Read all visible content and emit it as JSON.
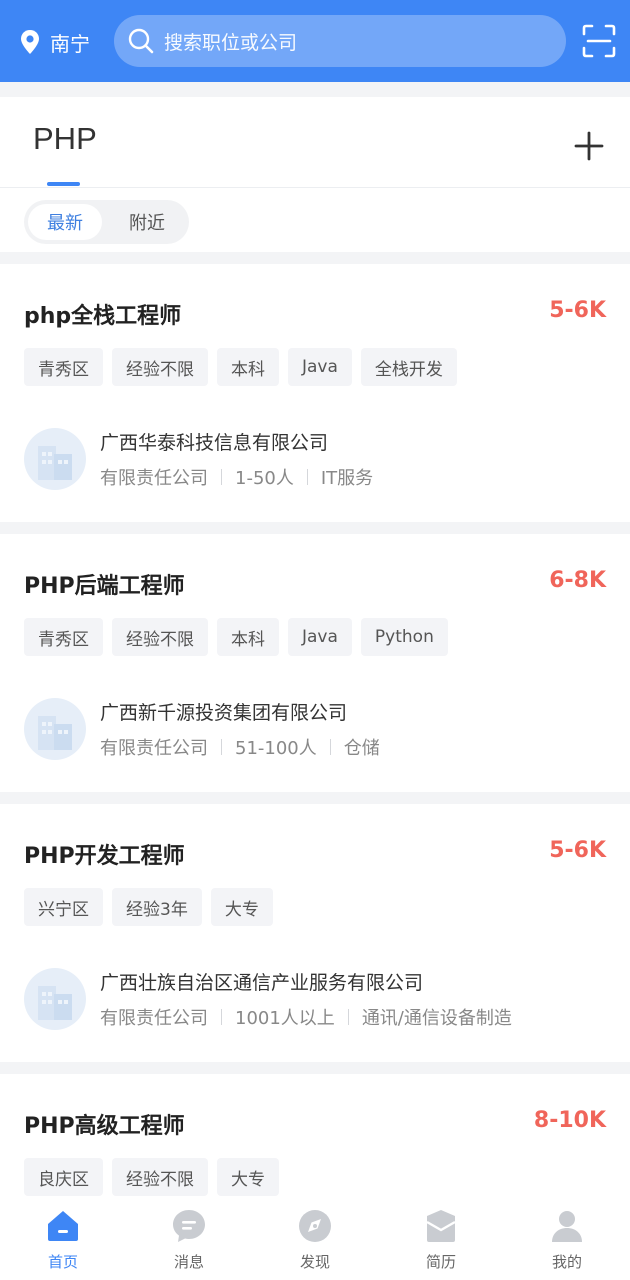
{
  "header": {
    "city": "南宁",
    "search_placeholder": "搜索职位或公司"
  },
  "filter": {
    "keyword_tab": "PHP",
    "sort_options": [
      "最新",
      "附近"
    ],
    "selected_sort": "最新"
  },
  "jobs": [
    {
      "title": "php全栈工程师",
      "salary": "5-6K",
      "tags": [
        "青秀区",
        "经验不限",
        "本科",
        "Java",
        "全栈开发"
      ],
      "company": "广西华泰科技信息有限公司",
      "company_type": "有限责任公司",
      "company_size": "1-50人",
      "industry": "IT服务"
    },
    {
      "title": "PHP后端工程师",
      "salary": "6-8K",
      "tags": [
        "青秀区",
        "经验不限",
        "本科",
        "Java",
        "Python"
      ],
      "company": "广西新千源投资集团有限公司",
      "company_type": "有限责任公司",
      "company_size": "51-100人",
      "industry": "仓储"
    },
    {
      "title": "PHP开发工程师",
      "salary": "5-6K",
      "tags": [
        "兴宁区",
        "经验3年",
        "大专"
      ],
      "company": "广西壮族自治区通信产业服务有限公司",
      "company_type": "有限责任公司",
      "company_size": "1001人以上",
      "industry": "通讯/通信设备制造"
    },
    {
      "title": "PHP高级工程师",
      "salary": "8-10K",
      "tags": [
        "良庆区",
        "经验不限",
        "大专"
      ]
    }
  ],
  "nav": {
    "items": [
      {
        "label": "首页",
        "icon": "home-icon"
      },
      {
        "label": "消息",
        "icon": "message-icon"
      },
      {
        "label": "发现",
        "icon": "discover-icon"
      },
      {
        "label": "简历",
        "icon": "resume-icon"
      },
      {
        "label": "我的",
        "icon": "profile-icon"
      }
    ],
    "active_index": 0
  },
  "colors": {
    "brand_blue": "#3e86f5",
    "salary_red": "#f0655a"
  }
}
